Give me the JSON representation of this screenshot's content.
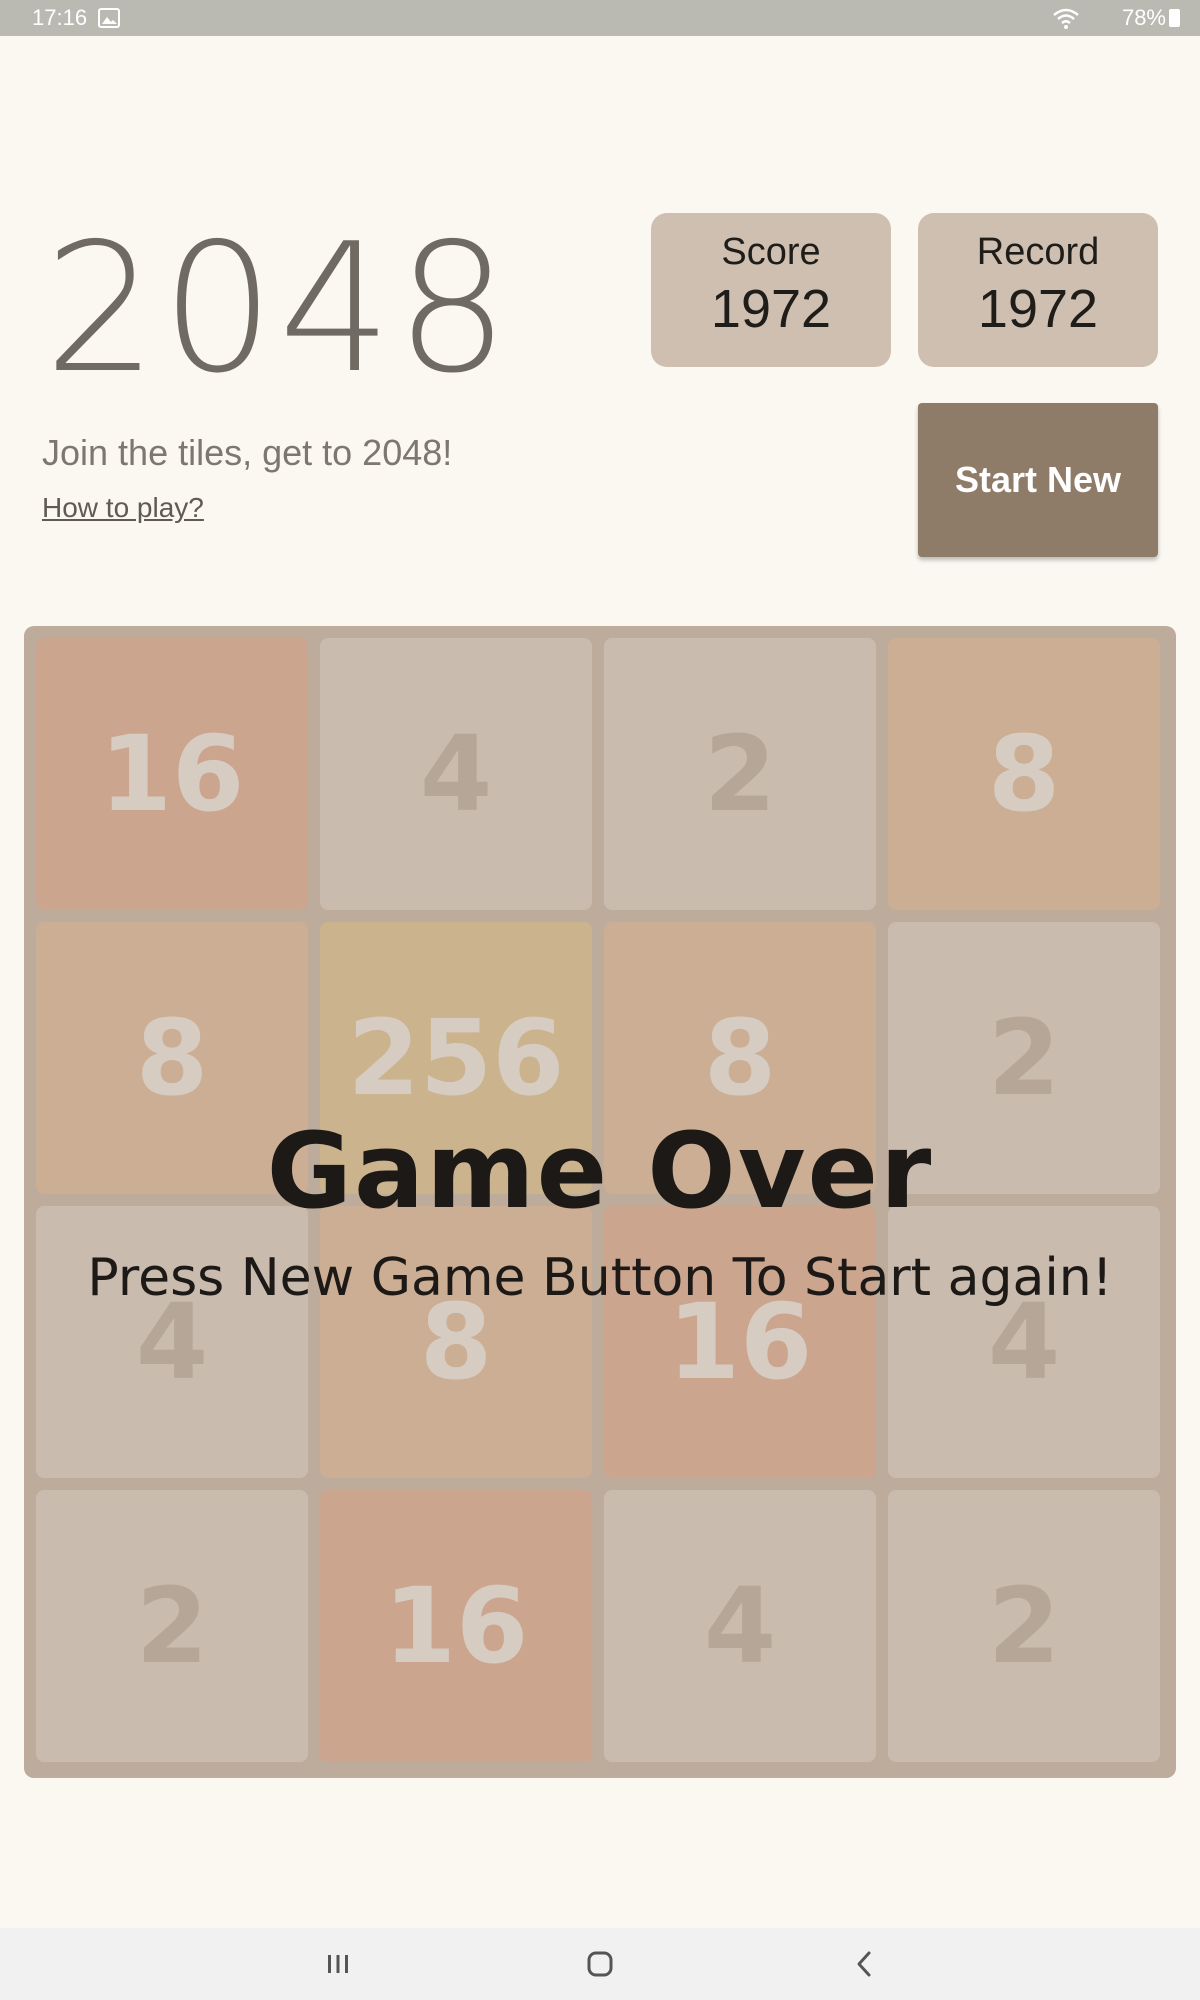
{
  "status_bar": {
    "time": "17:16",
    "battery": "78%",
    "icons": [
      "image-icon",
      "wifi-icon",
      "battery-icon"
    ]
  },
  "header": {
    "title": "2048",
    "tagline": "Join the tiles, get to 2048!",
    "how_to_play": "How to play?"
  },
  "score": {
    "label": "Score",
    "value": "1972"
  },
  "record": {
    "label": "Record",
    "value": "1972"
  },
  "start_new_label": "Start New",
  "board": {
    "rows": [
      [
        "16",
        "4",
        "2",
        "8"
      ],
      [
        "8",
        "256",
        "8",
        "2"
      ],
      [
        "4",
        "8",
        "16",
        "4"
      ],
      [
        "2",
        "16",
        "4",
        "2"
      ]
    ]
  },
  "game_over": {
    "title": "Game Over",
    "subtitle": "Press New Game Button To Start again!"
  },
  "colors": {
    "background": "#faf8f1",
    "board": "#bdab9b",
    "score_box": "#cebfb0",
    "start_new": "#8e7b68",
    "tile_2": "#c9bbad",
    "tile_4": "#c9bbad",
    "tile_8": "#cbae93",
    "tile_16": "#cba58e",
    "tile_256": "#cbb38e",
    "text_small_tile": "#b5a697",
    "text_large_tile": "#d6ccc2"
  },
  "nav_bar": {
    "icons": [
      "recent-apps-icon",
      "home-icon",
      "back-icon"
    ]
  }
}
